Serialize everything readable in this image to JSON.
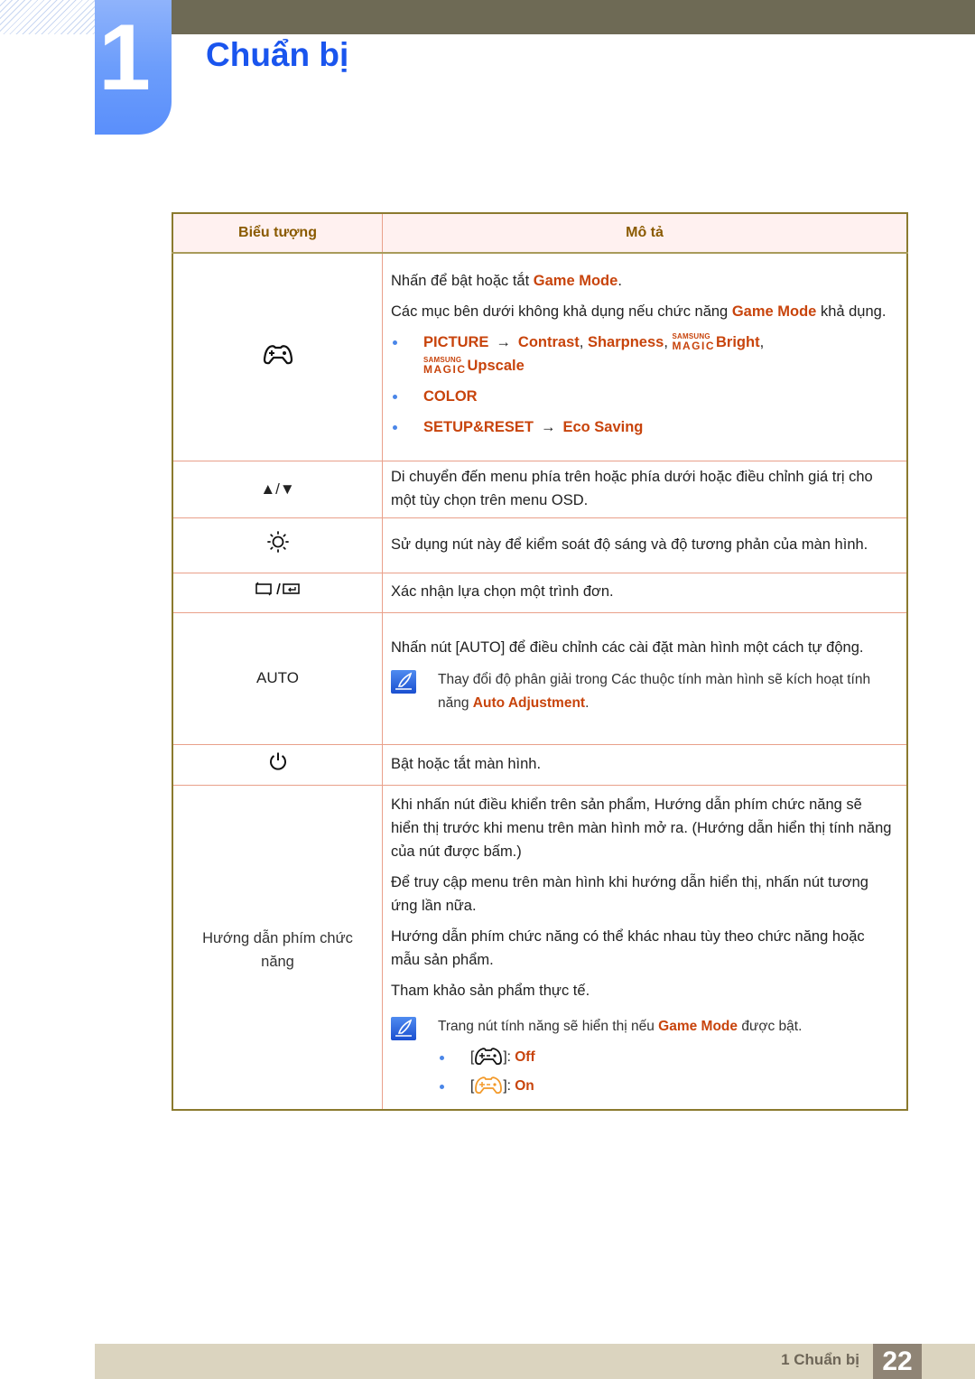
{
  "chapter": {
    "number": "1",
    "title": "Chuẩn bị"
  },
  "colors": {
    "accent_blue": "#1a55ee",
    "highlight": "#c8440c",
    "header_bg": "#fff1f0",
    "footer_bg": "#dbd4bf",
    "bullet": "#4a86e8"
  },
  "table": {
    "headers": {
      "icon": "Biểu tượng",
      "description": "Mô tả"
    },
    "rows": {
      "game": {
        "icon": "gamepad-icon",
        "p1_pre": "Nhấn để bật hoặc tắt ",
        "p1_hl": "Game Mode",
        "p1_post": ".",
        "p2_pre": "Các mục bên dưới không khả dụng nếu chức năng ",
        "p2_hl": "Game Mode",
        "p2_post": " khả dụng.",
        "items": {
          "picture": "PICTURE",
          "arrow": "→",
          "contrast": "Contrast",
          "sep": ", ",
          "sharpness": "Sharpness",
          "magic_top": "SAMSUNG",
          "magic_bottom": "MAGIC",
          "bright": "Bright",
          "comma": ",",
          "upscale": "Upscale",
          "color": "COLOR",
          "setup": "SETUP&RESET",
          "eco": "Eco Saving"
        }
      },
      "updown": {
        "icon": "▲/▼",
        "text": "Di chuyển đến menu phía trên hoặc phía dưới hoặc điều chỉnh giá trị cho một tùy chọn trên menu OSD."
      },
      "brightness": {
        "icon": "brightness-icon",
        "text": "Sử dụng nút này để kiểm soát độ sáng và độ tương phản của màn hình."
      },
      "confirm": {
        "icon": "source-enter-icon",
        "text": "Xác nhận lựa chọn một trình đơn."
      },
      "auto": {
        "label": "AUTO",
        "text_pre": "Nhấn nút [",
        "text_key": "AUTO",
        "text_post": "] để điều chỉnh các cài đặt màn hình một cách tự động.",
        "note_pre": "Thay đổi độ phân giải trong Các thuộc tính màn hình sẽ kích hoạt tính năng ",
        "note_hl": "Auto Adjustment",
        "note_post": "."
      },
      "power": {
        "icon": "power-icon",
        "text": "Bật hoặc tắt màn hình."
      },
      "guide": {
        "label": "Hướng dẫn phím chức năng",
        "p1": "Khi nhấn nút điều khiển trên sản phẩm, Hướng dẫn phím chức năng sẽ hiển thị trước khi menu trên màn hình mở ra. (Hướng dẫn hiển thị tính năng của nút được bấm.)",
        "p2": "Để truy cập menu trên màn hình khi hướng dẫn hiển thị, nhấn nút tương ứng lần nữa.",
        "p3": "Hướng dẫn phím chức năng có thể khác nhau tùy theo chức năng hoặc mẫu sản phẩm.",
        "p4": "Tham khảo sản phẩm thực tế.",
        "note_pre": "Trang nút tính năng sẽ hiển thị nếu ",
        "note_hl": "Game Mode",
        "note_post": " được bật.",
        "states": [
          {
            "icon": "gamepad-off-icon",
            "open": "[",
            "close": "]: ",
            "label": "Off"
          },
          {
            "icon": "gamepad-on-icon",
            "open": "[",
            "close": "]: ",
            "label": "On"
          }
        ]
      }
    }
  },
  "footer": {
    "label": "1 Chuẩn bị",
    "page": "22"
  }
}
